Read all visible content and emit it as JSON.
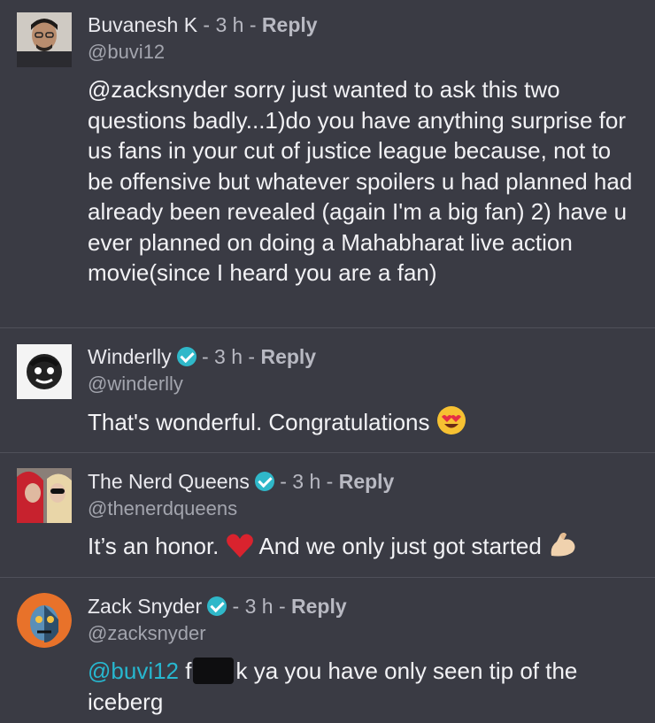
{
  "comments": [
    {
      "name": "Buvanesh K",
      "time": "3 h",
      "reply_label": "Reply",
      "handle": "@buvi12",
      "text": "@zacksnyder sorry just wanted to ask this two questions badly...1)do you have anything surprise for us fans in your cut of justice league because, not to be offensive but whatever spoilers u had planned had already been revealed (again I'm a big fan) 2) have u ever planned on doing a Mahabharat live action movie(since I heard you are a fan)"
    },
    {
      "name": "Winderlly",
      "time": "3 h",
      "reply_label": "Reply",
      "handle": "@winderlly",
      "text": "That's wonderful. Congratulations",
      "emoji": "heart-eyes-emoji"
    },
    {
      "name": "The Nerd Queens",
      "time": "3 h",
      "reply_label": "Reply",
      "handle": "@thenerdqueens",
      "text_a": "It’s an honor.",
      "text_b": "And we only just got started",
      "emojis": [
        "red-heart-emoji",
        "flexed-biceps-emoji"
      ]
    },
    {
      "name": "Zack Snyder",
      "time": "3 h",
      "reply_label": "Reply",
      "handle": "@zacksnyder",
      "mention": "@buvi12",
      "prefix": "f",
      "text": "k ya you have only seen tip of the iceberg"
    }
  ],
  "separator": "-",
  "colors": {
    "background": "#3a3b44",
    "verified": "#2fb8c9",
    "mention": "#27b7cf"
  }
}
